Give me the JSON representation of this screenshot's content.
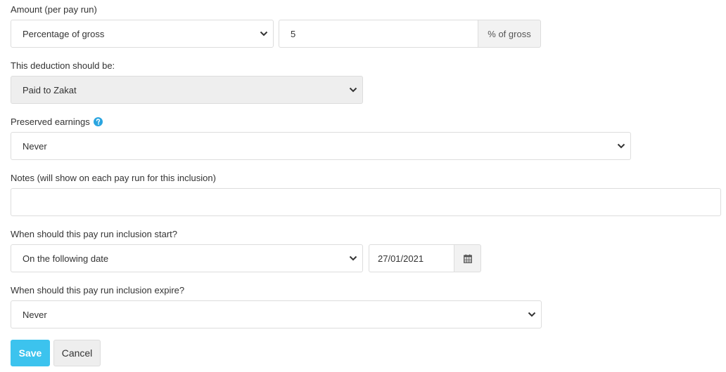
{
  "amount": {
    "label": "Amount (per pay run)",
    "type_value": "Percentage of gross",
    "value": "5",
    "addon": "% of gross"
  },
  "deduction": {
    "label": "This deduction should be:",
    "value": "Paid to Zakat"
  },
  "preserved": {
    "label": "Preserved earnings",
    "value": "Never",
    "help_icon": "question-circle"
  },
  "notes": {
    "label": "Notes (will show on each pay run for this inclusion)",
    "value": ""
  },
  "start": {
    "label": "When should this pay run inclusion start?",
    "value": "On the following date",
    "date": "27/01/2021",
    "date_icon": "calendar"
  },
  "expire": {
    "label": "When should this pay run inclusion expire?",
    "value": "Never"
  },
  "actions": {
    "save_label": "Save",
    "cancel_label": "Cancel"
  },
  "colors": {
    "primary": "#3cc3ee",
    "help": "#2aa5e0"
  }
}
